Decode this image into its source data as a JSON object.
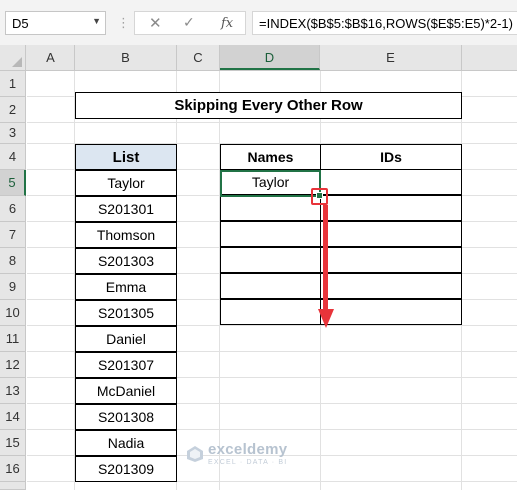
{
  "formula_bar": {
    "name_box": "D5",
    "cancel_glyph": "✕",
    "enter_glyph": "✓",
    "fx_label": "fx",
    "formula": "=INDEX($B$5:$B$16,ROWS($E$5:E5)*2-1)"
  },
  "columns": [
    "A",
    "B",
    "C",
    "D",
    "E"
  ],
  "selected_column": "D",
  "rows": [
    "1",
    "2",
    "3",
    "4",
    "5",
    "6",
    "7",
    "8",
    "9",
    "10",
    "11",
    "12",
    "13",
    "14",
    "15",
    "16"
  ],
  "selected_row": "5",
  "sheet": {
    "title": "Skipping Every Other Row",
    "list_header": "List",
    "list": [
      "Taylor",
      "S201301",
      "Thomson",
      "S201303",
      "Emma",
      "S201305",
      "Daniel",
      "S201307",
      "McDaniel",
      "S201308",
      "Nadia",
      "S201309"
    ],
    "names_header": "Names",
    "ids_header": "IDs",
    "names_values": [
      "Taylor",
      "",
      "",
      "",
      "",
      ""
    ],
    "ids_values": [
      "",
      "",
      "",
      "",
      "",
      ""
    ]
  },
  "watermark": {
    "name": "exceldemy",
    "tagline": "EXCEL · DATA · BI"
  },
  "colors": {
    "accent_green": "#217346",
    "annotation_red": "#e8343a",
    "header_fill": "#dce6f1"
  },
  "icons": {
    "name_box_dropdown": "chevron-down-icon",
    "cancel": "close-icon",
    "enter": "check-icon",
    "function": "function-icon",
    "annotation": "down-arrow-icon"
  }
}
